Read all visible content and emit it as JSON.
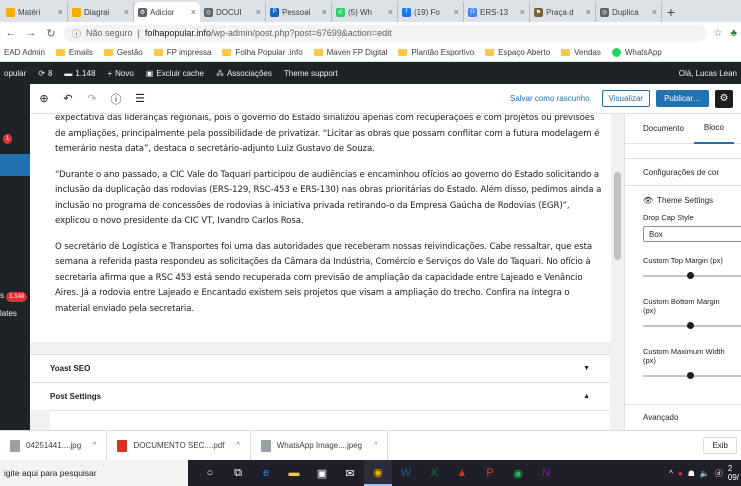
{
  "browser": {
    "tabs": [
      {
        "label": "Matéri",
        "fav_color": "#f9ab00",
        "fav_glyph": "",
        "active": false
      },
      {
        "label": "Diagrai",
        "fav_color": "#f9ab00",
        "fav_glyph": "",
        "active": false
      },
      {
        "label": "Adicior",
        "fav_color": "#5f6368",
        "fav_glyph": "⚙",
        "active": true
      },
      {
        "label": "DOCUI",
        "fav_color": "#5f6368",
        "fav_glyph": "◎",
        "active": false
      },
      {
        "label": "Pessoal",
        "fav_color": "#1565c0",
        "fav_glyph": "P",
        "active": false
      },
      {
        "label": "(5) Wh",
        "fav_color": "#25d366",
        "fav_glyph": "✆",
        "active": false
      },
      {
        "label": "(19) Fo",
        "fav_color": "#1877f2",
        "fav_glyph": "f",
        "active": false
      },
      {
        "label": "ERS-13",
        "fav_color": "#4285f4",
        "fav_glyph": "G",
        "active": false
      },
      {
        "label": "Praça d",
        "fav_color": "#7b5e3b",
        "fav_glyph": "⚑",
        "active": false
      },
      {
        "label": "Duplica",
        "fav_color": "#5f6368",
        "fav_glyph": "◎",
        "active": false
      }
    ],
    "new_tab": "+",
    "security_label": "Não seguro",
    "url_host": "folhapopular.info",
    "url_path": "/wp-admin/post.php?post=67699&action=edit"
  },
  "bookmarks": [
    {
      "label": "EAD Admin",
      "icon": "none"
    },
    {
      "label": "Emails",
      "icon": "folder"
    },
    {
      "label": "Gestão",
      "icon": "folder"
    },
    {
      "label": "FP impressa",
      "icon": "folder"
    },
    {
      "label": "Folha Popular .info",
      "icon": "folder"
    },
    {
      "label": "Maven FP Digital",
      "icon": "folder"
    },
    {
      "label": "Plantão Esportivo",
      "icon": "folder"
    },
    {
      "label": "Espaço Aberto",
      "icon": "folder"
    },
    {
      "label": "Vendas",
      "icon": "folder"
    },
    {
      "label": "WhatsApp",
      "icon": "whatsapp"
    }
  ],
  "adminbar": {
    "site": "opular",
    "updates": "8",
    "comments": "1.148",
    "new": "Novo",
    "clear_cache": "Excluir cache",
    "associations": "Associações",
    "theme_support": "Theme support",
    "greeting": "Olá, Lucas Lean"
  },
  "wpmenu": {
    "badge1": "1",
    "badge2": "1.148",
    "item_comments": "s",
    "item_templates": "lates"
  },
  "editor": {
    "saved_draft": "Salvar como rascunho",
    "preview": "Visualizar",
    "publish": "Publicar…"
  },
  "post": {
    "paragraphs": [
      "expectativa das lideranças regionais, pois o governo do Estado sinalizou apenas com recuperações e com projetos ou previsões de ampliações, principalmente pela possibilidade de privatizar. “Licitar as obras que possam conflitar com a futura modelagem é temerário nesta data”, destaca o secretário-adjunto Luiz Gustavo de Souza.",
      "“Durante o ano passado, a CIC Vale do Taquari participou de audiências e encaminhou ofícios ao governo do Estado solicitando a inclusão da duplicação das rodovias (ERS-129, RSC-453 e ERS-130) nas obras prioritárias do Estado. Além disso, pedimos ainda a inclusão no programa de concessões de rodovias à iniciativa privada retirando-o da Empresa Gaúcha de Rodovias (EGR)”, explicou o novo presidente da CIC VT, Ivandro Carlos Rosa.",
      "O secretário de Logística e Transportes foi uma das autoridades que receberam nossas reivindicações.  Cabe ressaltar, que esta semana a referida pasta respondeu as solicitações da Câmara da Indústria, Comércio e Serviços do Vale do Taquari.  No ofício à secretaria afirma que a RSC 453 está sendo recuperada com previsão de ampliação da capacidade entre Lajeado e Venâncio Aires. Já a rodovia entre Lajeado e Encantado existem seis projetos que visam a ampliação do trecho. Confira na íntegra o material enviado pela secretaria."
    ]
  },
  "metaboxes": {
    "yoast": "Yoast SEO",
    "post_settings": "Post Settings"
  },
  "sidebar": {
    "tab_document": "Documento",
    "tab_block": "Bloco",
    "color_settings": "Configurações de cor",
    "theme_settings": "Theme Settings",
    "drop_cap_label": "Drop Cap Style",
    "drop_cap_value": "Box",
    "top_margin": "Custom Top Margin (px)",
    "bottom_margin": "Custom Bottom Margin (px)",
    "max_width": "Custom Maximum Width (px)",
    "advanced": "Avançado"
  },
  "downloads": [
    {
      "label": "04251441....jpg",
      "color": "#9aa0a6"
    },
    {
      "label": "DOCUMENTO SEC....pdf",
      "color": "#d93025"
    },
    {
      "label": "WhatsApp Image....jpeg",
      "color": "#9aa0a6"
    }
  ],
  "downloads_exit": "Exib",
  "taskbar": {
    "search_placeholder": "igite aqui para pesquisar",
    "tray_time": "2",
    "tray_date": "09/"
  },
  "colors": {
    "wp_dark": "#1d2327",
    "wp_blue": "#2271b1",
    "taskbar": "#1f1f2a"
  }
}
